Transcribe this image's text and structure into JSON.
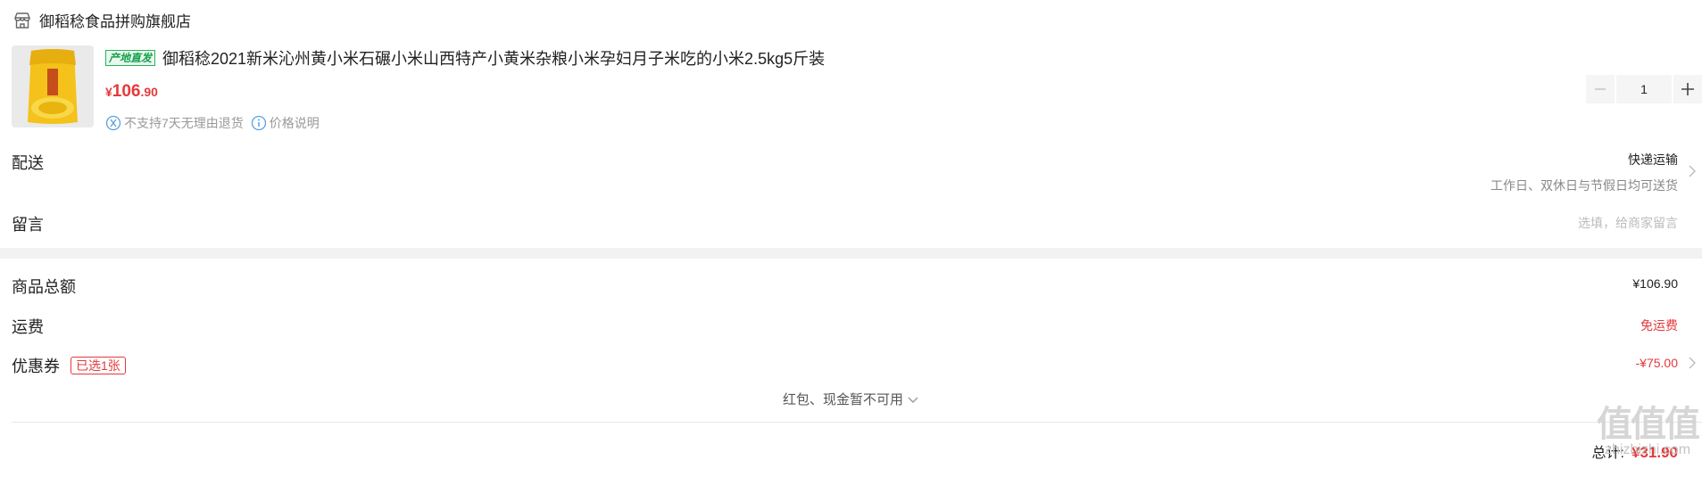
{
  "store": {
    "name": "御稻稔食品拼购旗舰店",
    "icon": "store-icon"
  },
  "product": {
    "origin_tag": "产地直发",
    "title": "御稻稔2021新米沁州黄小米石碾小米山西特产小黄米杂粮小米孕妇月子米吃的小米2.5kg5斤装",
    "price_currency": "¥",
    "price_int": "106",
    "price_dec": ".90",
    "note_return": "不支持7天无理由退货",
    "note_price": "价格说明",
    "quantity": "1"
  },
  "delivery": {
    "label": "配送",
    "method": "快递运输",
    "schedule": "工作日、双休日与节假日均可送货"
  },
  "message": {
    "label": "留言",
    "placeholder": "选填，给商家留言"
  },
  "summary": {
    "goods_total_label": "商品总额",
    "goods_total_value": "¥106.90",
    "shipping_label": "运费",
    "shipping_value": "免运费",
    "coupon_label": "优惠券",
    "coupon_badge": "已选1张",
    "coupon_value": "-¥75.00",
    "unavailable": "红包、现金暂不可用",
    "total_label": "总计:",
    "total_value": "¥31.90"
  },
  "watermark": {
    "glyphs": "值值值",
    "url": "zhizhizhi.com"
  },
  "colors": {
    "price_red": "#e4393c",
    "origin_green": "#13a14a"
  }
}
